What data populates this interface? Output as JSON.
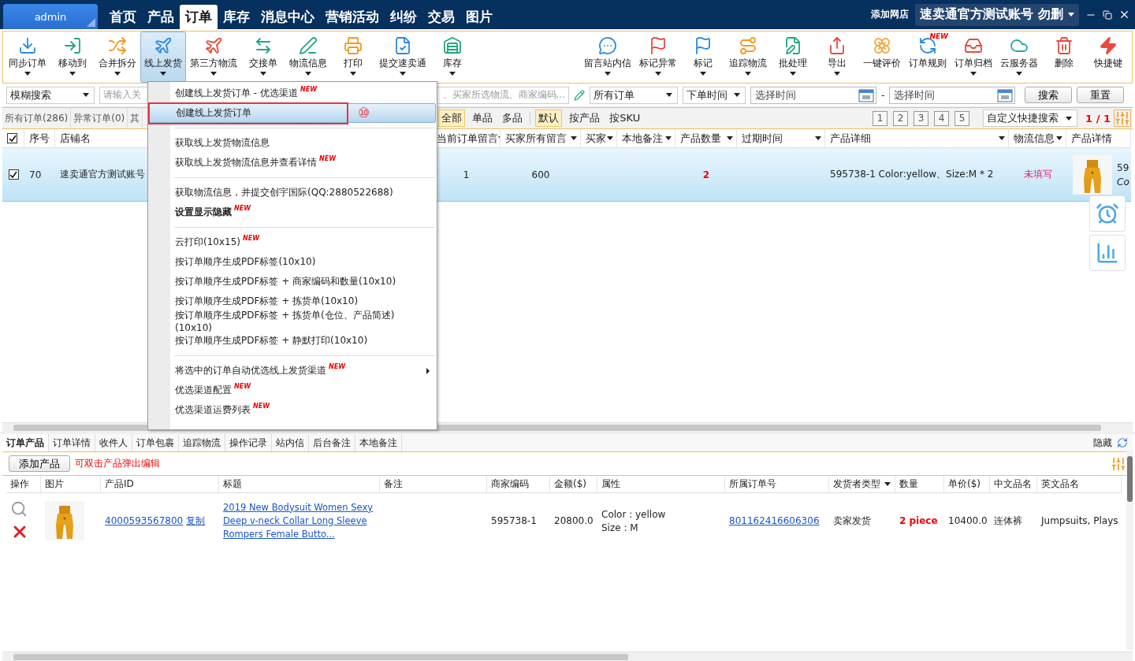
{
  "topbar": {
    "user": "admin",
    "nav": [
      {
        "label": "首页",
        "selected": false
      },
      {
        "label": "产品",
        "selected": false
      },
      {
        "label": "订单",
        "selected": true
      },
      {
        "label": "库存",
        "selected": false
      },
      {
        "label": "消息中心",
        "selected": false
      },
      {
        "label": "营销活动",
        "selected": false
      },
      {
        "label": "纠纷",
        "selected": false
      },
      {
        "label": "交易",
        "selected": false
      },
      {
        "label": "图片",
        "selected": false
      }
    ],
    "add_shop": "添加网店",
    "account": "速卖通官方测试账号 勿删"
  },
  "toolbar_left": [
    {
      "label": "同步订单",
      "dropdown": true,
      "selected": false
    },
    {
      "label": "移动到",
      "dropdown": true,
      "selected": false
    },
    {
      "label": "合并拆分",
      "dropdown": true,
      "selected": false
    },
    {
      "label": "线上发货",
      "dropdown": true,
      "selected": true
    },
    {
      "label": "第三方物流",
      "dropdown": true,
      "selected": false
    },
    {
      "label": "交接单",
      "dropdown": true,
      "selected": false
    },
    {
      "label": "物流信息",
      "dropdown": true,
      "selected": false
    },
    {
      "label": "打印",
      "dropdown": true,
      "selected": false
    },
    {
      "label": "提交速卖通",
      "dropdown": true,
      "selected": false
    },
    {
      "label": "库存",
      "dropdown": true,
      "selected": false
    }
  ],
  "toolbar_right": [
    {
      "label": "留言站内信",
      "dropdown": true
    },
    {
      "label": "标记异常",
      "dropdown": true
    },
    {
      "label": "标记",
      "dropdown": true
    },
    {
      "label": "追踪物流",
      "dropdown": true
    },
    {
      "label": "批处理",
      "dropdown": true
    },
    {
      "label": "导出",
      "dropdown": true
    },
    {
      "label": "一键评价",
      "dropdown": false
    },
    {
      "label": "订单规则",
      "dropdown": false,
      "badge": "NEW"
    },
    {
      "label": "订单归档",
      "dropdown": true
    },
    {
      "label": "云服务器",
      "dropdown": true
    },
    {
      "label": "删除",
      "dropdown": false
    },
    {
      "label": "快捷键",
      "dropdown": false
    }
  ],
  "filters": {
    "search_mode": "模糊搜索",
    "keyword_placeholder_start": "请输入关",
    "keyword_placeholder_end": "、买家所选物流、商家编码...",
    "order_scope": "所有订单",
    "time_type": "下单时间",
    "date_from": "选择时间",
    "date_separator": "-",
    "date_to": "选择时间",
    "search_button": "搜索",
    "reset_button": "重置"
  },
  "order_tabs": [
    {
      "label": "所有订单(286)",
      "selected": false
    },
    {
      "label": "异常订单(0)",
      "selected": false
    },
    {
      "label": "其",
      "selected": false
    }
  ],
  "product_filter": [
    {
      "label": "全部",
      "selected": true
    },
    {
      "label": "单品",
      "selected": false
    },
    {
      "label": "多品",
      "selected": false
    }
  ],
  "sort_filter": [
    {
      "label": "默认",
      "selected": true
    },
    {
      "label": "按产品",
      "selected": false
    },
    {
      "label": "按SKU",
      "selected": false
    }
  ],
  "pages": [
    "1",
    "2",
    "3",
    "4",
    "5"
  ],
  "quick_search": "自定义快捷搜索",
  "page_info": "1 / 1",
  "table": {
    "all_checked": true,
    "columns": [
      {
        "label": "序号",
        "filter": false
      },
      {
        "label": "店铺名",
        "filter": false
      },
      {
        "label": "当前订单留言",
        "filter": true
      },
      {
        "label": "买家所有留言",
        "filter": true
      },
      {
        "label": "买家",
        "filter": true
      },
      {
        "label": "本地备注",
        "filter": true
      },
      {
        "label": "产品数量",
        "filter": true
      },
      {
        "label": "过期时间",
        "filter": true
      },
      {
        "label": "产品详细",
        "filter": true
      },
      {
        "label": "物流信息",
        "filter": true
      },
      {
        "label": "产品详情",
        "filter": false
      }
    ],
    "rows": [
      {
        "checked": true,
        "selected": true,
        "no": "70",
        "shop": "速卖通官方测试账号",
        "current_message": "1",
        "all_messages": "600",
        "quantity": "2",
        "product_detail": "595738-1  Color:yellow、Size:M * 2",
        "logistics": "未填写",
        "info_lines": [
          "59",
          "Co"
        ]
      }
    ]
  },
  "menu": {
    "annotation": "⑩",
    "groups": [
      [
        {
          "label": "创建线上发货订单 - 优选渠道",
          "badge": "NEW",
          "bold": false,
          "submenu": false,
          "selected": false
        },
        {
          "label": "创建线上发货订单",
          "bold": false,
          "submenu": false,
          "selected": true
        }
      ],
      [
        {
          "label": "获取线上发货物流信息",
          "bold": false,
          "submenu": false,
          "selected": false
        },
        {
          "label": "获取线上发货物流信息并查看详情",
          "badge": "NEW",
          "bold": false,
          "submenu": false,
          "selected": false
        }
      ],
      [
        {
          "label": "获取物流信息，并提交创宇国际(QQ:2880522688)",
          "bold": false,
          "submenu": false,
          "selected": false
        },
        {
          "label": "设置显示隐藏",
          "badge": "NEW",
          "bold": true,
          "submenu": false,
          "selected": false
        }
      ],
      [
        {
          "label": "云打印(10x15)",
          "badge": "NEW",
          "bold": false,
          "submenu": false,
          "selected": false
        },
        {
          "label": "按订单顺序生成PDF标签(10x10)",
          "bold": false,
          "submenu": false,
          "selected": false
        },
        {
          "label": "按订单顺序生成PDF标签 + 商家编码和数量(10x10)",
          "bold": false,
          "submenu": false,
          "selected": false
        },
        {
          "label": "按订单顺序生成PDF标签 + 拣货单(10x10)",
          "bold": false,
          "submenu": false,
          "selected": false
        },
        {
          "label": "按订单顺序生成PDF标签 + 拣货单(仓位、产品简述)(10x10)",
          "bold": false,
          "submenu": false,
          "selected": false
        },
        {
          "label": "按订单顺序生成PDF标签 + 静默打印(10x10)",
          "bold": false,
          "submenu": false,
          "selected": false
        }
      ],
      [
        {
          "label": "将选中的订单自动优选线上发货渠道",
          "badge": "NEW",
          "bold": false,
          "submenu": true,
          "selected": false
        },
        {
          "label": "优选渠道配置",
          "badge": "NEW",
          "bold": false,
          "submenu": false,
          "selected": false
        },
        {
          "label": "优选渠道运费列表",
          "badge": "NEW",
          "bold": false,
          "submenu": false,
          "selected": false
        }
      ]
    ]
  },
  "detail_tabs": [
    {
      "label": "订单产品",
      "selected": true
    },
    {
      "label": "订单详情",
      "selected": false
    },
    {
      "label": "收件人",
      "selected": false
    },
    {
      "label": "订单包裹",
      "selected": false
    },
    {
      "label": "追踪物流",
      "selected": false
    },
    {
      "label": "操作记录",
      "selected": false
    },
    {
      "label": "站内信",
      "selected": false
    },
    {
      "label": "后台备注",
      "selected": false
    },
    {
      "label": "本地备注",
      "selected": false
    }
  ],
  "hide_label": "隐藏",
  "add_product": "添加产品",
  "edit_hint": "可双击产品弹出编辑",
  "products": {
    "columns": [
      {
        "label": "操作",
        "filter": false
      },
      {
        "label": "图片",
        "filter": false
      },
      {
        "label": "产品ID",
        "filter": false
      },
      {
        "label": "标题",
        "filter": false
      },
      {
        "label": "备注",
        "filter": false
      },
      {
        "label": "商家编码",
        "filter": false
      },
      {
        "label": "金额($)",
        "filter": false
      },
      {
        "label": "属性",
        "filter": false
      },
      {
        "label": "所属订单号",
        "filter": false
      },
      {
        "label": "发货者类型",
        "filter": true
      },
      {
        "label": "数量",
        "filter": false
      },
      {
        "label": "单价($)",
        "filter": false
      },
      {
        "label": "中文品名",
        "filter": false
      },
      {
        "label": "英文品名",
        "filter": false
      }
    ],
    "rows": [
      {
        "product_id": "4000593567800",
        "copy": "复制",
        "title": "2019 New Bodysuit Women Sexy Deep v-neck Collar Long Sleeve Rompers Female Butto...",
        "sku": "595738-1",
        "amount": "20800.0",
        "attributes": [
          "Color : yellow",
          "Size : M"
        ],
        "order_no": "801162416606306",
        "shipper": "卖家发货",
        "quantity": "2 piece",
        "unit_price": "10400.0",
        "cn_name": "连体裤",
        "en_name": "Jumpsuits, Plays"
      }
    ]
  }
}
